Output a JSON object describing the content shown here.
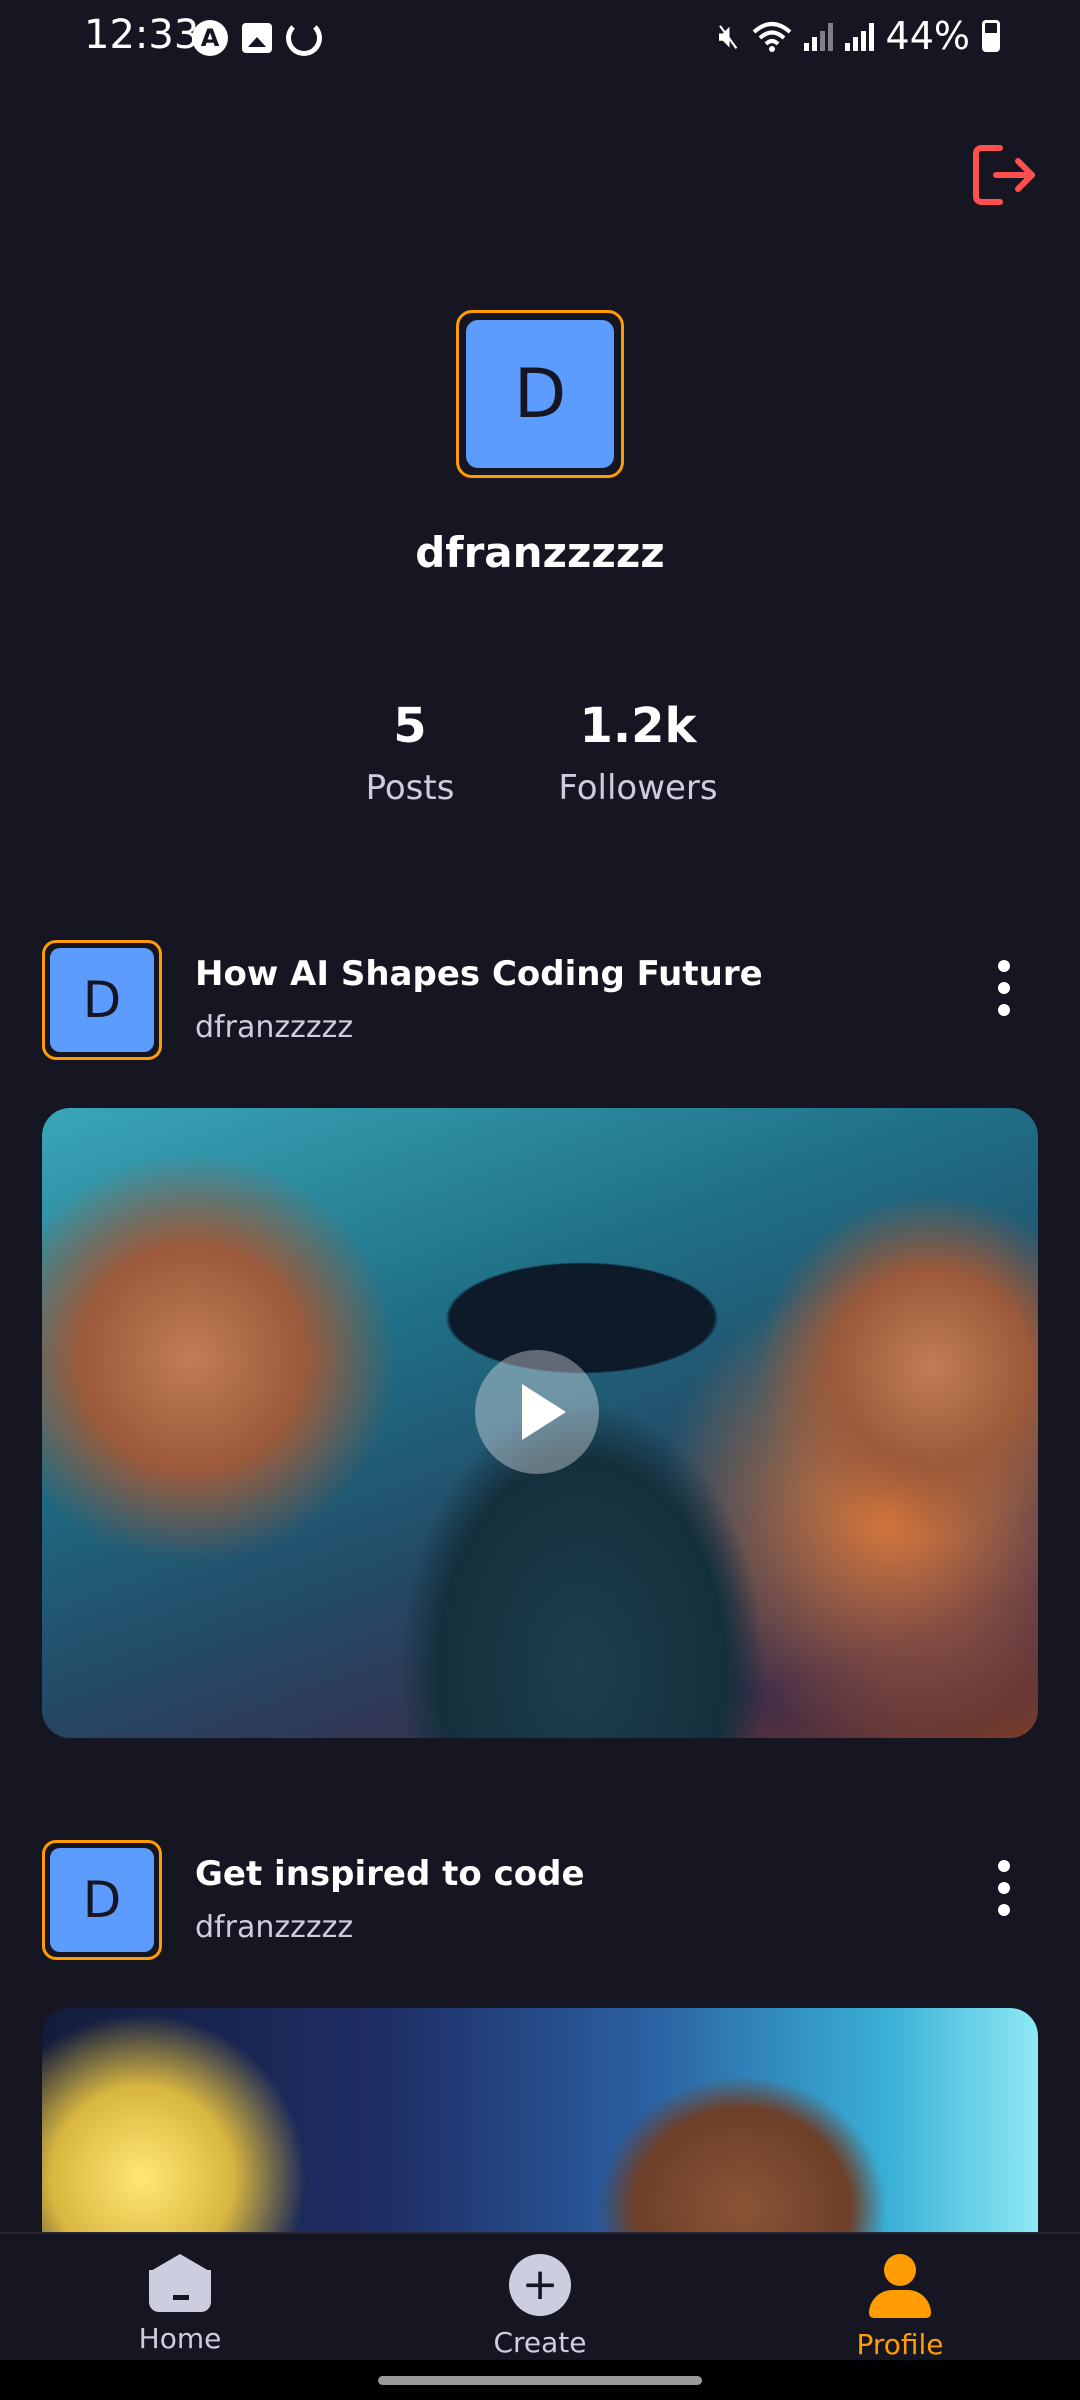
{
  "status_bar": {
    "time": "12:33",
    "battery": "44%",
    "icons_left": [
      "app-icon",
      "image-icon",
      "sync-icon"
    ],
    "icons_right": [
      "mute-icon",
      "wifi-icon",
      "signal-icon",
      "signal-icon",
      "battery-icon"
    ]
  },
  "profile": {
    "avatar_letter": "D",
    "username": "dfranzzzzz",
    "stats": [
      {
        "value": "5",
        "label": "Posts"
      },
      {
        "value": "1.2k",
        "label": "Followers"
      }
    ]
  },
  "posts": [
    {
      "avatar_letter": "D",
      "title": "How AI Shapes Coding Future",
      "author": "dfranzzzzz",
      "has_play_button": true
    },
    {
      "avatar_letter": "D",
      "title": "Get inspired to code",
      "author": "dfranzzzzz",
      "has_play_button": false
    }
  ],
  "bottom_nav": {
    "tabs": [
      {
        "label": "Home",
        "icon": "home-icon",
        "active": false
      },
      {
        "label": "Create",
        "icon": "plus-icon",
        "active": false
      },
      {
        "label": "Profile",
        "icon": "profile-icon",
        "active": true
      }
    ]
  },
  "colors": {
    "background": "#161622",
    "accent": "#FF9C01",
    "avatar_fill": "#5c9cff",
    "logout": "#FF4F4F",
    "muted_text": "#CDCDE0"
  }
}
